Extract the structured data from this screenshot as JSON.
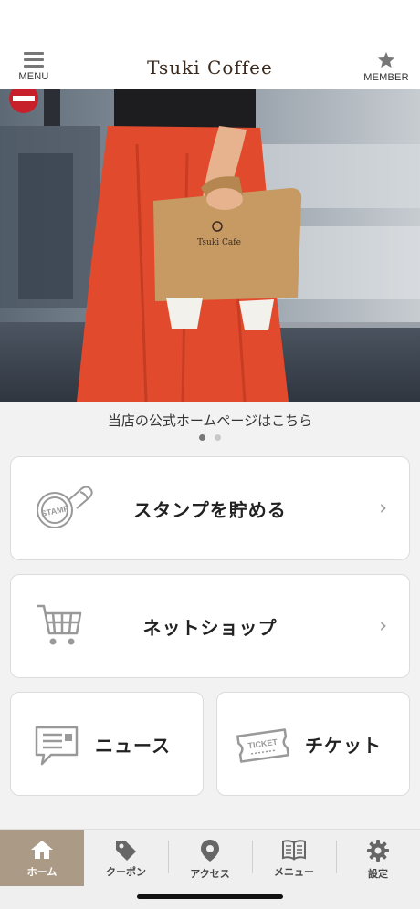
{
  "header": {
    "menu_label": "MENU",
    "brand": "Tsuki Coffee",
    "member_label": "MEMBER"
  },
  "hero": {
    "caption": "当店の公式ホームページはこちら",
    "carousel_total": 2,
    "carousel_active": 1,
    "bag_text": "Tsuki Cafe"
  },
  "cards": {
    "stamp": {
      "title": "スタンプを貯める",
      "icon": "stamp-icon",
      "icon_text": "STAMP"
    },
    "shop": {
      "title": "ネットショップ",
      "icon": "shopping-cart-icon"
    },
    "news": {
      "title": "ニュース",
      "icon": "news-icon"
    },
    "ticket": {
      "title": "チケット",
      "icon": "ticket-icon",
      "icon_text": "TICKET"
    }
  },
  "tabs": [
    {
      "label": "ホーム",
      "icon": "home-icon",
      "active": true
    },
    {
      "label": "クーポン",
      "icon": "tag-icon",
      "active": false
    },
    {
      "label": "アクセス",
      "icon": "map-pin-icon",
      "active": false
    },
    {
      "label": "メニュー",
      "icon": "book-icon",
      "active": false
    },
    {
      "label": "設定",
      "icon": "gear-icon",
      "active": false
    }
  ],
  "colors": {
    "accent": "#ab9a86",
    "brand_text": "#3a2a1e",
    "skirt": "#e14a2c",
    "bag": "#c79a64"
  }
}
